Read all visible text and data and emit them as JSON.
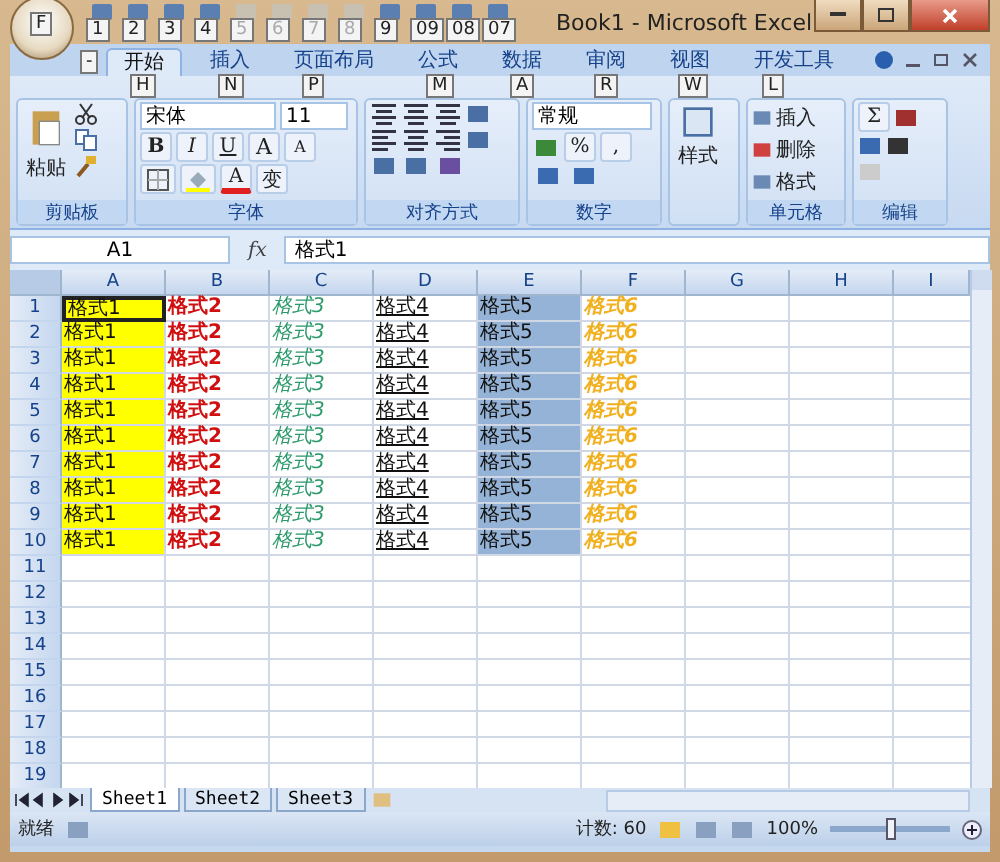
{
  "window": {
    "title": "Book1 - Microsoft Excel",
    "office_keytip": "F",
    "menu_keytip": "-"
  },
  "quick_access": [
    {
      "keytip": "1",
      "disabled": false
    },
    {
      "keytip": "2",
      "disabled": false
    },
    {
      "keytip": "3",
      "disabled": false
    },
    {
      "keytip": "4",
      "disabled": false
    },
    {
      "keytip": "5",
      "disabled": true
    },
    {
      "keytip": "6",
      "disabled": true
    },
    {
      "keytip": "7",
      "disabled": true
    },
    {
      "keytip": "8",
      "disabled": true
    },
    {
      "keytip": "9",
      "disabled": false
    },
    {
      "keytip": "09",
      "disabled": false
    },
    {
      "keytip": "08",
      "disabled": false
    },
    {
      "keytip": "07",
      "disabled": false
    }
  ],
  "tabs": [
    {
      "label": "开始",
      "keytip": "H",
      "selected": true
    },
    {
      "label": "插入",
      "keytip": "N",
      "selected": false
    },
    {
      "label": "页面布局",
      "keytip": "P",
      "selected": false
    },
    {
      "label": "公式",
      "keytip": "M",
      "selected": false
    },
    {
      "label": "数据",
      "keytip": "A",
      "selected": false
    },
    {
      "label": "审阅",
      "keytip": "R",
      "selected": false
    },
    {
      "label": "视图",
      "keytip": "W",
      "selected": false
    },
    {
      "label": "开发工具",
      "keytip": "L",
      "selected": false
    }
  ],
  "clipboard": {
    "title": "剪贴板",
    "paste": "粘贴"
  },
  "font": {
    "title": "字体",
    "name": "宋体",
    "size": "11",
    "phonetic": "变",
    "color_label": "A",
    "buttons": [
      {
        "label": "B",
        "kind": "bold"
      },
      {
        "label": "I",
        "kind": "italic"
      },
      {
        "label": "U",
        "kind": "underline"
      },
      {
        "label": "A",
        "kind": "grow"
      },
      {
        "label": "A",
        "kind": "shrink"
      }
    ]
  },
  "alignment": {
    "title": "对齐方式"
  },
  "number": {
    "title": "数字",
    "format": "常规",
    "percent": "%",
    "comma": ","
  },
  "styles": {
    "label": "样式"
  },
  "cells": {
    "title": "单元格",
    "buttons": [
      "插入",
      "删除",
      "格式"
    ]
  },
  "editing": {
    "title": "编辑",
    "sum": "Σ"
  },
  "formula_bar": {
    "name_box": "A1",
    "fx": "fx",
    "value": "格式1"
  },
  "sheet": {
    "columns": [
      {
        "label": "A",
        "kind": "highlighted"
      },
      {
        "label": "B",
        "kind": "bold"
      },
      {
        "label": "C",
        "kind": "italic"
      },
      {
        "label": "D",
        "kind": "underlined"
      },
      {
        "label": "E",
        "kind": "shaded"
      },
      {
        "label": "F",
        "kind": "emphasized"
      },
      {
        "label": "G",
        "kind": "plain"
      },
      {
        "label": "H",
        "kind": "plain"
      },
      {
        "label": "I",
        "kind": "plain"
      }
    ],
    "rows": [
      {
        "header": "1",
        "cells": [
          "格式1",
          "格式2",
          "格式3",
          "格式4",
          "格式5",
          "格式6"
        ]
      },
      {
        "header": "2",
        "cells": [
          "格式1",
          "格式2",
          "格式3",
          "格式4",
          "格式5",
          "格式6"
        ]
      },
      {
        "header": "3",
        "cells": [
          "格式1",
          "格式2",
          "格式3",
          "格式4",
          "格式5",
          "格式6"
        ]
      },
      {
        "header": "4",
        "cells": [
          "格式1",
          "格式2",
          "格式3",
          "格式4",
          "格式5",
          "格式6"
        ]
      },
      {
        "header": "5",
        "cells": [
          "格式1",
          "格式2",
          "格式3",
          "格式4",
          "格式5",
          "格式6"
        ]
      },
      {
        "header": "6",
        "cells": [
          "格式1",
          "格式2",
          "格式3",
          "格式4",
          "格式5",
          "格式6"
        ]
      },
      {
        "header": "7",
        "cells": [
          "格式1",
          "格式2",
          "格式3",
          "格式4",
          "格式5",
          "格式6"
        ]
      },
      {
        "header": "8",
        "cells": [
          "格式1",
          "格式2",
          "格式3",
          "格式4",
          "格式5",
          "格式6"
        ]
      },
      {
        "header": "9",
        "cells": [
          "格式1",
          "格式2",
          "格式3",
          "格式4",
          "格式5",
          "格式6"
        ]
      },
      {
        "header": "10",
        "cells": [
          "格式1",
          "格式2",
          "格式3",
          "格式4",
          "格式5",
          "格式6"
        ]
      },
      {
        "header": "11",
        "cells": []
      },
      {
        "header": "12",
        "cells": []
      },
      {
        "header": "13",
        "cells": []
      },
      {
        "header": "14",
        "cells": []
      },
      {
        "header": "15",
        "cells": []
      },
      {
        "header": "16",
        "cells": []
      },
      {
        "header": "17",
        "cells": []
      },
      {
        "header": "18",
        "cells": []
      },
      {
        "header": "19",
        "cells": []
      }
    ]
  },
  "sheet_tabs": [
    {
      "label": "Sheet1",
      "selected": true
    },
    {
      "label": "Sheet2",
      "selected": false
    },
    {
      "label": "Sheet3",
      "selected": false
    }
  ],
  "status_bar": {
    "mode": "就绪",
    "count": "计数: 60",
    "zoom": "100%",
    "zoom_slider": {
      "level": 0.5
    }
  }
}
